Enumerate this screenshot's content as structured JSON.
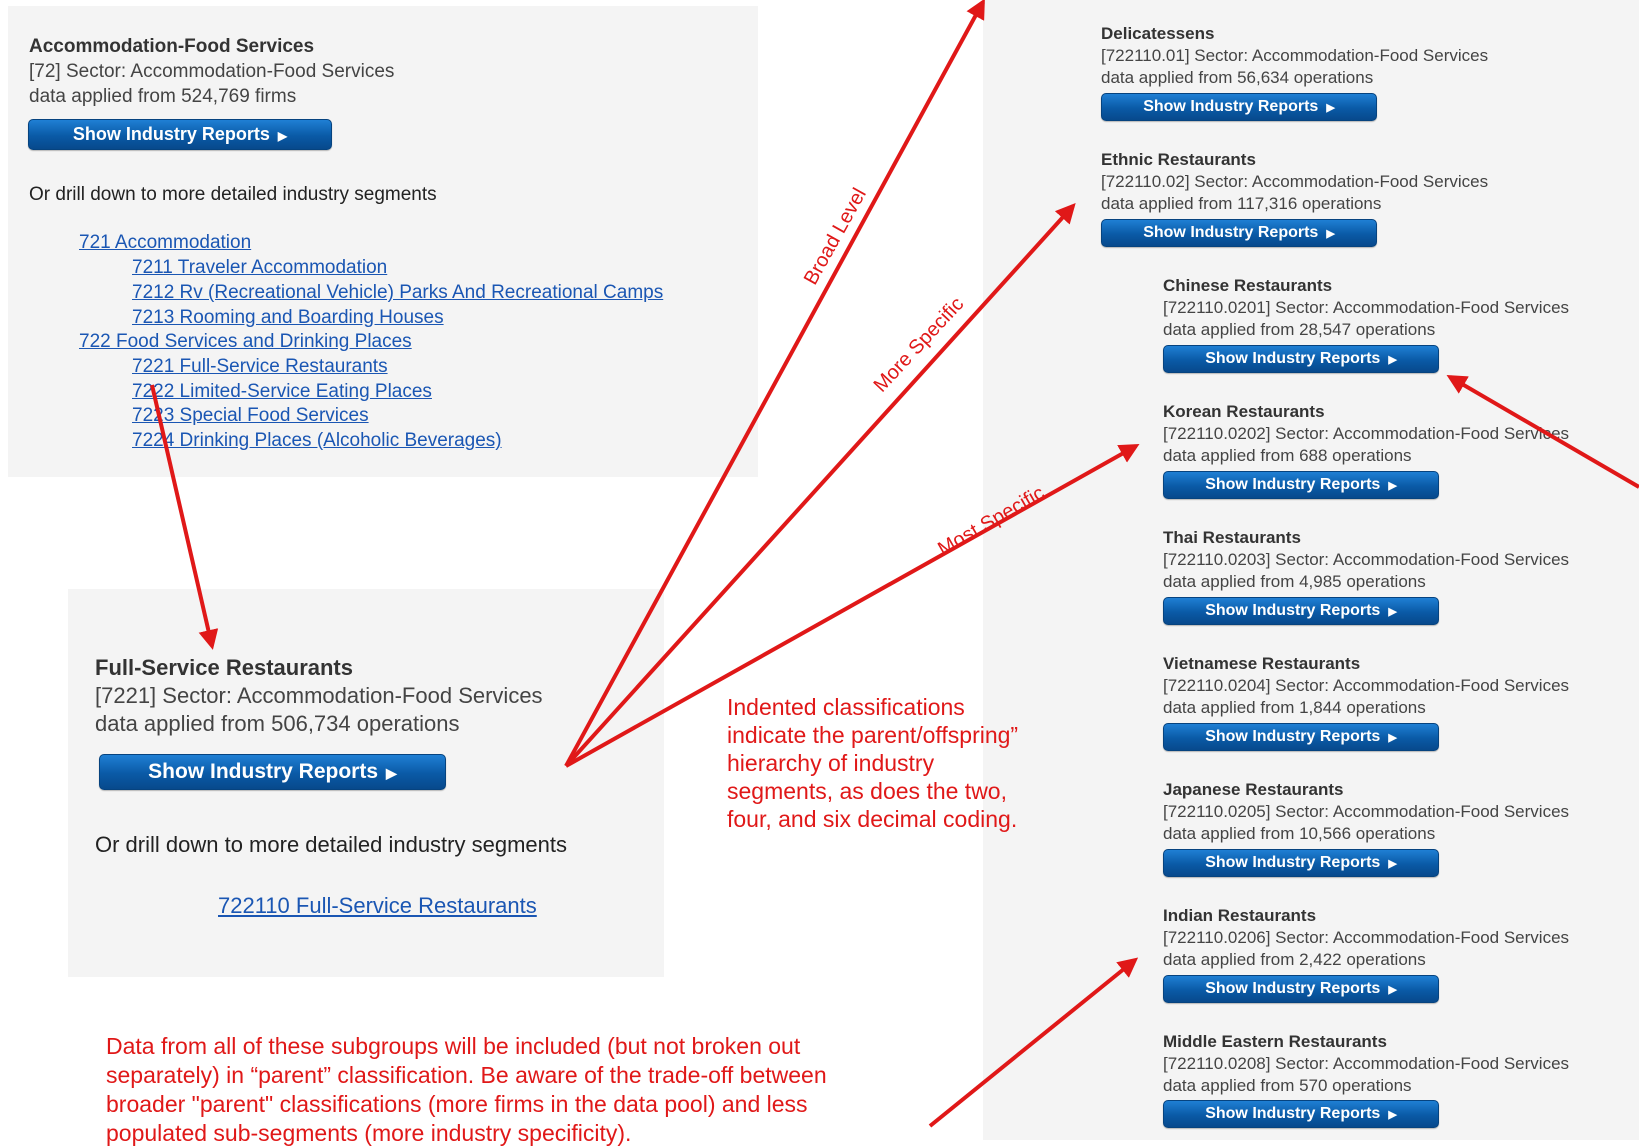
{
  "top_panel": {
    "title": "Accommodation-Food Services",
    "code_line": "[72] Sector: Accommodation-Food Services",
    "data_line": "data applied from 524,769 firms",
    "button": "Show Industry Reports",
    "drill_heading": "Or drill down to more detailed industry segments",
    "links": [
      "721 Accommodation",
      "7211 Traveler Accommodation",
      "7212 Rv (Recreational Vehicle) Parks And Recreational Camps",
      "7213 Rooming and Boarding Houses",
      "722 Food Services and Drinking Places",
      "7221 Full-Service Restaurants",
      "7222 Limited-Service Eating Places",
      "7223 Special Food Services",
      "7224 Drinking Places (Alcoholic Beverages)"
    ]
  },
  "mid_panel": {
    "title": "Full-Service Restaurants",
    "code_line": "[7221] Sector: Accommodation-Food Services",
    "data_line": "data applied from 506,734 operations",
    "button": "Show Industry Reports",
    "drill_heading": "Or drill down to more detailed industry segments",
    "link": "722110 Full-Service Restaurants"
  },
  "right_panel": {
    "button": "Show Industry Reports",
    "items": [
      {
        "title": "Delicatessens",
        "code_line": "[722110.01] Sector: Accommodation-Food Services",
        "data_line": "data applied from 56,634 operations"
      },
      {
        "title": "Ethnic Restaurants",
        "code_line": "[722110.02] Sector: Accommodation-Food Services",
        "data_line": "data applied from 117,316 operations"
      },
      {
        "title": "Chinese Restaurants",
        "code_line": "[722110.0201] Sector: Accommodation-Food Services",
        "data_line": "data applied from 28,547 operations"
      },
      {
        "title": "Korean Restaurants",
        "code_line": "[722110.0202] Sector: Accommodation-Food Services",
        "data_line": "data applied from 688 operations"
      },
      {
        "title": "Thai Restaurants",
        "code_line": "[722110.0203] Sector: Accommodation-Food Services",
        "data_line": "data applied from 4,985 operations"
      },
      {
        "title": "Vietnamese Restaurants",
        "code_line": "[722110.0204] Sector: Accommodation-Food Services",
        "data_line": "data applied from 1,844 operations"
      },
      {
        "title": "Japanese Restaurants",
        "code_line": "[722110.0205] Sector: Accommodation-Food Services",
        "data_line": "data applied from 10,566 operations"
      },
      {
        "title": "Indian Restaurants",
        "code_line": "[722110.0206] Sector: Accommodation-Food Services",
        "data_line": "data applied from 2,422 operations"
      },
      {
        "title": "Middle Eastern Restaurants",
        "code_line": "[722110.0208] Sector: Accommodation-Food Services",
        "data_line": "data applied from 570 operations"
      }
    ]
  },
  "annotations": {
    "broad_level": "Broad Level",
    "more_specific": "More Specific",
    "most_specific": "Most Specific",
    "hierarchy_note": [
      "Indented classifications",
      "indicate  the parent/offspring”",
      "hierarchy of industry",
      "segments, as does the two,",
      "four, and six decimal coding."
    ],
    "bottom_note": [
      "Data from all of these subgroups will be included (but not broken out",
      "separately) in “parent” classification. Be aware of the trade-off between",
      "broader \"parent\" classifications (more firms in the data pool) and less",
      "populated sub-segments (more industry specificity)."
    ]
  },
  "colors": {
    "annotation_red": "#e01818",
    "button_blue": "#0a5aa6",
    "link_blue": "#1a56b3",
    "panel_bg": "#f4f4f4"
  }
}
